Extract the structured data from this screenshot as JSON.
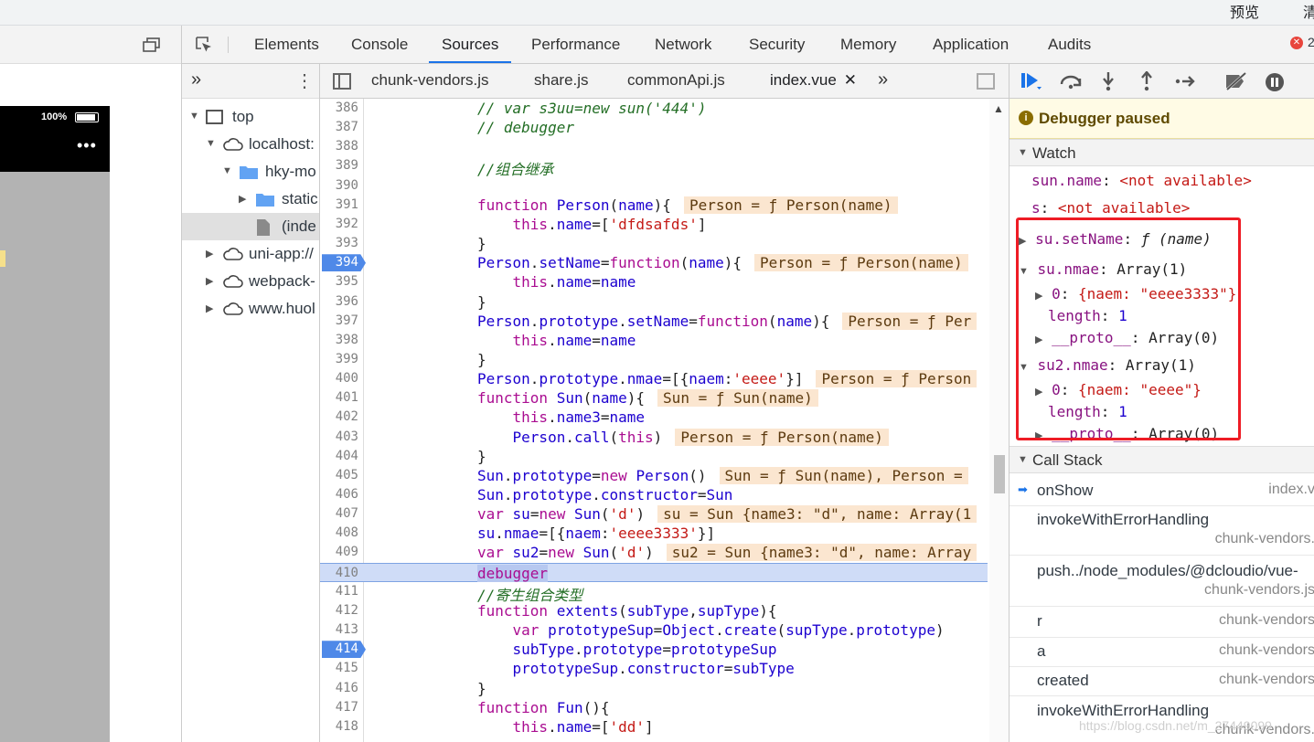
{
  "topstrip": {
    "label_preview": "预览",
    "label_right": "清"
  },
  "device": {
    "battery": "100%",
    "menu_dots": "•••"
  },
  "devtools": {
    "tabs": [
      "Elements",
      "Console",
      "Sources",
      "Performance",
      "Network",
      "Security",
      "Memory",
      "Application",
      "Audits"
    ],
    "active_tab": "Sources",
    "error_count": "2",
    "error_glyph": "✕"
  },
  "navigator": {
    "overflow_glyph": "»",
    "more_glyph": "⋮",
    "tree": [
      "top",
      "localhost:",
      "hky-mo",
      "static",
      "(inde",
      "uni-app://",
      "webpack-",
      "www.huol"
    ]
  },
  "editor": {
    "file_tabs": [
      "chunk-vendors.js",
      "share.js",
      "commonApi.js",
      "index.vue"
    ],
    "active_file": "index.vue",
    "close_glyph": "✕",
    "overflow_glyph": "»",
    "scroll_up_glyph": "▲",
    "breakpoints": [
      394,
      414
    ],
    "current_line": 410,
    "lines": [
      {
        "n": "386",
        "code": "// var s3uu=new sun('444')"
      },
      {
        "n": "387",
        "code": "// debugger"
      },
      {
        "n": "388",
        "code": ""
      },
      {
        "n": "389",
        "code": "//组合继承"
      },
      {
        "n": "390",
        "code": ""
      },
      {
        "n": "391",
        "code": "function Person(name){",
        "inline": "Person = ƒ Person(name)"
      },
      {
        "n": "392",
        "code": "    this.name=['dfdsafds']"
      },
      {
        "n": "393",
        "code": "}"
      },
      {
        "n": "394",
        "code": "Person.setName=function(name){",
        "inline": "Person = ƒ Person(name)"
      },
      {
        "n": "395",
        "code": "    this.name=name"
      },
      {
        "n": "396",
        "code": "}"
      },
      {
        "n": "397",
        "code": "Person.prototype.setName=function(name){",
        "inline": "Person = ƒ Per"
      },
      {
        "n": "398",
        "code": "    this.name=name"
      },
      {
        "n": "399",
        "code": "}"
      },
      {
        "n": "400",
        "code": "Person.prototype.nmae=[{naem:'eeee'}]",
        "inline": "Person = ƒ Person"
      },
      {
        "n": "401",
        "code": "function Sun(name){",
        "inline": "Sun = ƒ Sun(name)"
      },
      {
        "n": "402",
        "code": "    this.name3=name"
      },
      {
        "n": "403",
        "code": "    Person.call(this)",
        "inline": "Person = ƒ Person(name)"
      },
      {
        "n": "404",
        "code": "}"
      },
      {
        "n": "405",
        "code": "Sun.prototype=new Person()",
        "inline": "Sun = ƒ Sun(name), Person ="
      },
      {
        "n": "406",
        "code": "Sun.prototype.constructor=Sun"
      },
      {
        "n": "407",
        "code": "var su=new Sun('d')",
        "inline": "su = Sun {name3: \"d\", name: Array(1"
      },
      {
        "n": "408",
        "code": "su.nmae=[{naem:'eeee3333'}]"
      },
      {
        "n": "409",
        "code": "var su2=new Sun('d')",
        "inline": "su2 = Sun {name3: \"d\", name: Array"
      },
      {
        "n": "410",
        "code": "debugger"
      },
      {
        "n": "411",
        "code": "//寄生组合类型"
      },
      {
        "n": "412",
        "code": "function extents(subType,supType){"
      },
      {
        "n": "413",
        "code": "    var prototypeSup=Object.create(supType.prototype)"
      },
      {
        "n": "414",
        "code": "    subType.prototype=prototypeSup"
      },
      {
        "n": "415",
        "code": "    prototypeSup.constructor=subType"
      },
      {
        "n": "416",
        "code": "}"
      },
      {
        "n": "417",
        "code": "function Fun(){"
      },
      {
        "n": "418",
        "code": "    this.name=['dd']"
      }
    ]
  },
  "sidebar": {
    "paused_text": "Debugger paused",
    "paused_icon": "i",
    "watch_title": "Watch",
    "watch": [
      {
        "key": "sun.name",
        "value": "<not available>"
      },
      {
        "key": "s",
        "value": "<not available>"
      },
      {
        "key": "su.setName",
        "value": "ƒ (name)"
      },
      {
        "key": "su.nmae",
        "value": "Array(1)"
      },
      {
        "key": "0",
        "value": "{naem: \"eeee3333\"}"
      },
      {
        "key": "length",
        "value": "1"
      },
      {
        "key": "__proto__",
        "value": "Array(0)"
      },
      {
        "key": "su2.nmae",
        "value": "Array(1)"
      },
      {
        "key": "0",
        "value": "{naem: \"eeee\"}"
      },
      {
        "key": "length",
        "value": "1"
      },
      {
        "key": "__proto__",
        "value": "Array(0)"
      }
    ],
    "callstack_title": "Call Stack",
    "callstack": [
      {
        "fn": "onShow",
        "loc": "index.v"
      },
      {
        "fn": "invokeWithErrorHandling",
        "loc": "chunk-vendors."
      },
      {
        "fn": "push../node_modules/@dcloudio/vue-",
        "loc": "chunk-vendors.js"
      },
      {
        "fn": "r",
        "loc": "chunk-vendors"
      },
      {
        "fn": "a",
        "loc": "chunk-vendors"
      },
      {
        "fn": "created",
        "loc": "chunk-vendors"
      },
      {
        "fn": "invokeWithErrorHandling",
        "loc": "chunk-vendors."
      }
    ]
  },
  "watermark": "https://blog.csdn.net/m_27449099"
}
